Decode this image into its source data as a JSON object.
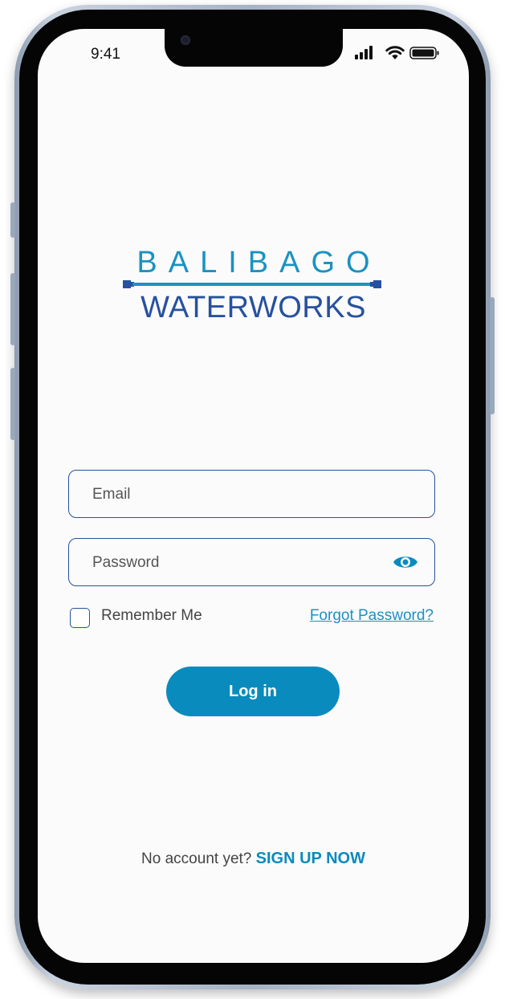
{
  "status_bar": {
    "time": "9:41"
  },
  "logo": {
    "line1": "BALIBAGO",
    "line2": "WATERWORKS"
  },
  "form": {
    "email_placeholder": "Email",
    "password_placeholder": "Password",
    "remember_label": "Remember Me",
    "forgot_label": "Forgot Password?",
    "login_label": "Log in"
  },
  "footer": {
    "prompt": "No account yet?",
    "signup_label": "SIGN UP NOW"
  },
  "colors": {
    "brand_light": "#1b92c1",
    "brand_dark": "#27519f",
    "button": "#0a8bbd"
  }
}
